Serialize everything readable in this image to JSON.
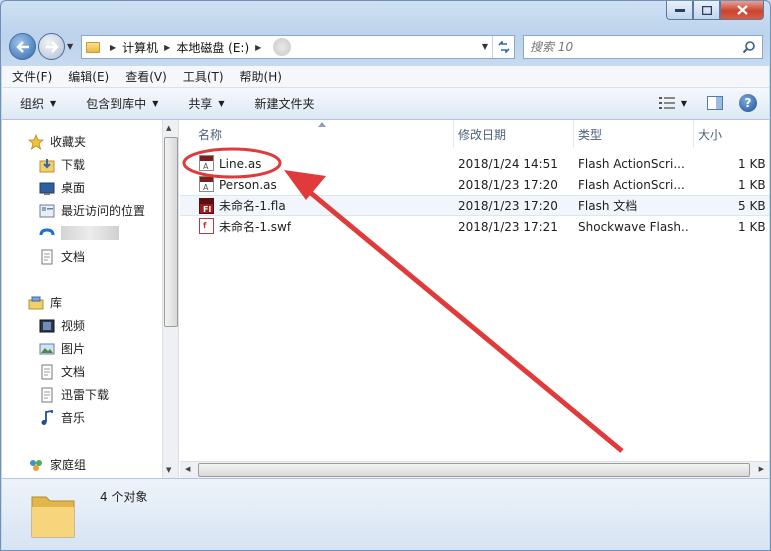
{
  "address_bar": {
    "crumbs": [
      "计算机",
      "本地磁盘 (E:)"
    ]
  },
  "search": {
    "placeholder": "搜索 10"
  },
  "menu": [
    "文件(F)",
    "编辑(E)",
    "查看(V)",
    "工具(T)",
    "帮助(H)"
  ],
  "commands": {
    "organize": "组织",
    "include_library": "包含到库中",
    "share": "共享",
    "new_folder": "新建文件夹"
  },
  "nav_pane": {
    "favorites_title": "收藏夹",
    "favorites": [
      "下载",
      "桌面",
      "最近访问的位置",
      "",
      "文档"
    ],
    "libraries_title": "库",
    "libraries": [
      "视频",
      "图片",
      "文档",
      "迅雷下载",
      "音乐"
    ],
    "homegroup": "家庭组"
  },
  "columns": {
    "name": "名称",
    "date": "修改日期",
    "type": "类型",
    "size": "大小"
  },
  "files": [
    {
      "name": "Line.as",
      "date": "2018/1/24 14:51",
      "type": "Flash ActionScri...",
      "size": "1 KB",
      "icon": "actionscript-file-icon"
    },
    {
      "name": "Person.as",
      "date": "2018/1/23 17:20",
      "type": "Flash ActionScri...",
      "size": "1 KB",
      "icon": "actionscript-file-icon"
    },
    {
      "name": "未命名-1.fla",
      "date": "2018/1/23 17:20",
      "type": "Flash 文档",
      "size": "5 KB",
      "icon": "fla-file-icon"
    },
    {
      "name": "未命名-1.swf",
      "date": "2018/1/23 17:21",
      "type": "Shockwave Flash...",
      "size": "1 KB",
      "icon": "swf-file-icon"
    }
  ],
  "status": {
    "item_count": "4 个对象"
  },
  "colors": {
    "annotation_red": "#e03a3a",
    "window_frame": "#bcd3ec",
    "selection": "#f1f6fc"
  }
}
